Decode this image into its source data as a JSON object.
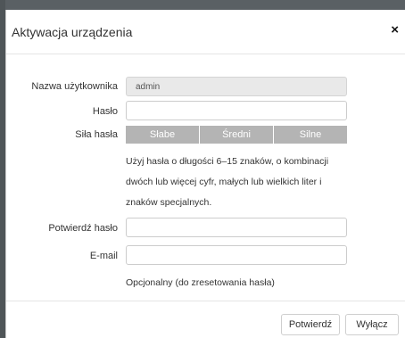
{
  "dialog": {
    "title": "Aktywacja urządzenia",
    "close_glyph": "×"
  },
  "form": {
    "username_label": "Nazwa użytkownika",
    "username_value": "admin",
    "password_label": "Hasło",
    "password_value": "",
    "strength_label": "Siła hasła",
    "strength_levels": [
      "Słabe",
      "Średni",
      "Silne"
    ],
    "hint_lines": [
      "Użyj hasła o długości 6–15 znaków, o kombinacji",
      "dwóch lub więcej cyfr, małych lub wielkich liter i",
      "znaków specjalnych."
    ],
    "confirm_label": "Potwierdź hasło",
    "confirm_value": "",
    "email_label": "E-mail",
    "email_value": "",
    "email_hint": "Opcjonalny (do zresetowania hasła)"
  },
  "footer": {
    "confirm_button": "Potwierdź",
    "off_button": "Wyłącz"
  },
  "colors": {
    "strength_inactive": "#b4b4b4",
    "readonly_field": "#e9e9e9"
  }
}
